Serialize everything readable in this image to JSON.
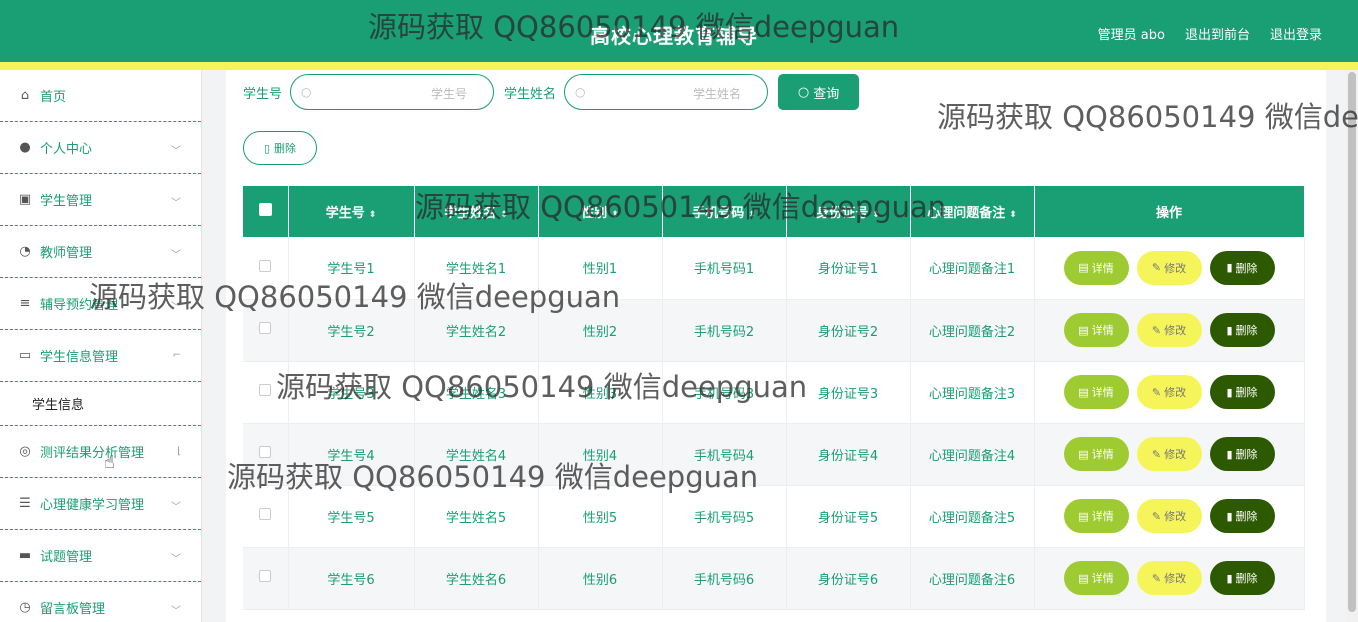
{
  "app": {
    "title": "高校心理教育辅导",
    "user_label": "管理员 abo",
    "to_front_label": "退出到前台",
    "logout_label": "退出登录"
  },
  "sidebar": {
    "items": [
      {
        "label": "首页",
        "icon": "home-icon"
      },
      {
        "label": "个人中心",
        "icon": "user-icon"
      },
      {
        "label": "学生管理",
        "icon": "clipboard-icon"
      },
      {
        "label": "教师管理",
        "icon": "gauge-icon"
      },
      {
        "label": "辅导预约管理",
        "icon": "sliders-icon"
      },
      {
        "label": "学生信息管理",
        "icon": "message-icon"
      },
      {
        "label": "测评结果分析管理",
        "icon": "circle-icon"
      },
      {
        "label": "心理健康学习管理",
        "icon": "list-icon"
      },
      {
        "label": "试题管理",
        "icon": "monitor-icon"
      },
      {
        "label": "留言板管理",
        "icon": "clock-icon"
      }
    ],
    "sub_item": "学生信息"
  },
  "search": {
    "student_no_label": "学生号",
    "student_no_placeholder": "学生号",
    "student_name_label": "学生姓名",
    "student_name_placeholder": "学生姓名",
    "query_label": "查询",
    "delete_label": "删除"
  },
  "table": {
    "headers": [
      "学生号",
      "学生姓名",
      "性别",
      "手机号码",
      "身份证号",
      "心理问题备注",
      "操作"
    ],
    "rows": [
      [
        "学生号1",
        "学生姓名1",
        "性别1",
        "手机号码1",
        "身份证号1",
        "心理问题备注1"
      ],
      [
        "学生号2",
        "学生姓名2",
        "性别2",
        "手机号码2",
        "身份证号2",
        "心理问题备注2"
      ],
      [
        "学生号3",
        "学生姓名3",
        "性别3",
        "手机号码3",
        "身份证号3",
        "心理问题备注3"
      ],
      [
        "学生号4",
        "学生姓名4",
        "性别4",
        "手机号码4",
        "身份证号4",
        "心理问题备注4"
      ],
      [
        "学生号5",
        "学生姓名5",
        "性别5",
        "手机号码5",
        "身份证号5",
        "心理问题备注5"
      ],
      [
        "学生号6",
        "学生姓名6",
        "性别6",
        "手机号码6",
        "身份证号6",
        "心理问题备注6"
      ]
    ],
    "actions": {
      "detail": "详情",
      "edit": "修改",
      "remove": "删除"
    }
  },
  "watermark": "源码获取 QQ86050149 微信deepguan",
  "colors": {
    "primary": "#1a9e73",
    "accent_yellow": "#f5f55a",
    "detail": "#9ecb32",
    "remove": "#2d5a00"
  }
}
